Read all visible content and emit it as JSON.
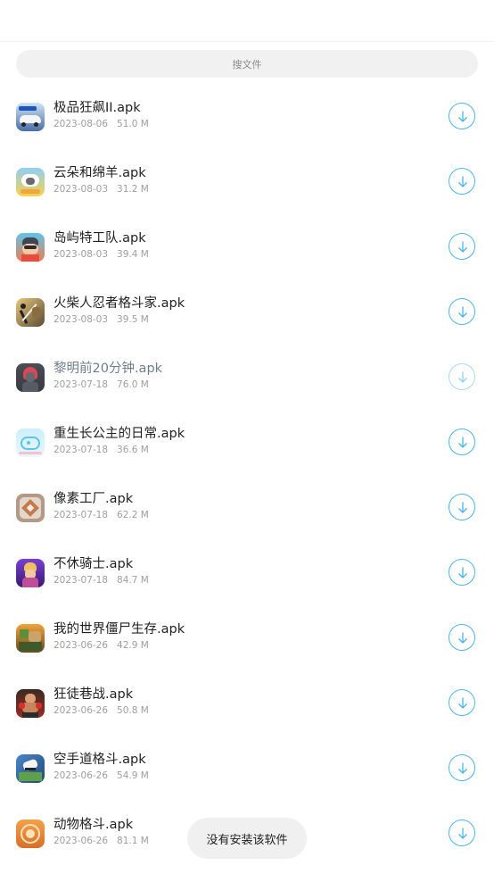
{
  "search": {
    "placeholder": "搜文件"
  },
  "files": [
    {
      "name": "极品狂飙II.apk",
      "date": "2023-08-06",
      "size": "51.0 M",
      "icon": "racing-car-icon"
    },
    {
      "name": "云朵和绵羊.apk",
      "date": "2023-08-03",
      "size": "31.2 M",
      "icon": "cloud-sheep-icon"
    },
    {
      "name": "岛屿特工队.apk",
      "date": "2023-08-03",
      "size": "39.4 M",
      "icon": "island-agent-icon"
    },
    {
      "name": "火柴人忍者格斗家.apk",
      "date": "2023-08-03",
      "size": "39.5 M",
      "icon": "stickman-ninja-icon"
    },
    {
      "name": "黎明前20分钟.apk",
      "date": "2023-07-18",
      "size": "76.0 M",
      "icon": "dawn-girl-icon"
    },
    {
      "name": "重生长公主的日常.apk",
      "date": "2023-07-18",
      "size": "36.6 M",
      "icon": "princess-whale-icon"
    },
    {
      "name": "像素工厂.apk",
      "date": "2023-07-18",
      "size": "62.2 M",
      "icon": "pixel-factory-icon"
    },
    {
      "name": "不休骑士.apk",
      "date": "2023-07-18",
      "size": "84.7 M",
      "icon": "knight-icon"
    },
    {
      "name": "我的世界僵尸生存.apk",
      "date": "2023-06-26",
      "size": "42.9 M",
      "icon": "zombie-survival-icon"
    },
    {
      "name": "狂徒巷战.apk",
      "date": "2023-06-26",
      "size": "50.8 M",
      "icon": "street-fighter-icon"
    },
    {
      "name": "空手道格斗.apk",
      "date": "2023-06-26",
      "size": "54.9 M",
      "icon": "karate-icon"
    },
    {
      "name": "动物格斗.apk",
      "date": "2023-06-26",
      "size": "81.1 M",
      "icon": "animal-fight-icon"
    }
  ],
  "toast": {
    "text": "没有安装该软件"
  },
  "colors": {
    "accent": "#4ab4ea",
    "toast_bg": "#f0f0f0"
  }
}
